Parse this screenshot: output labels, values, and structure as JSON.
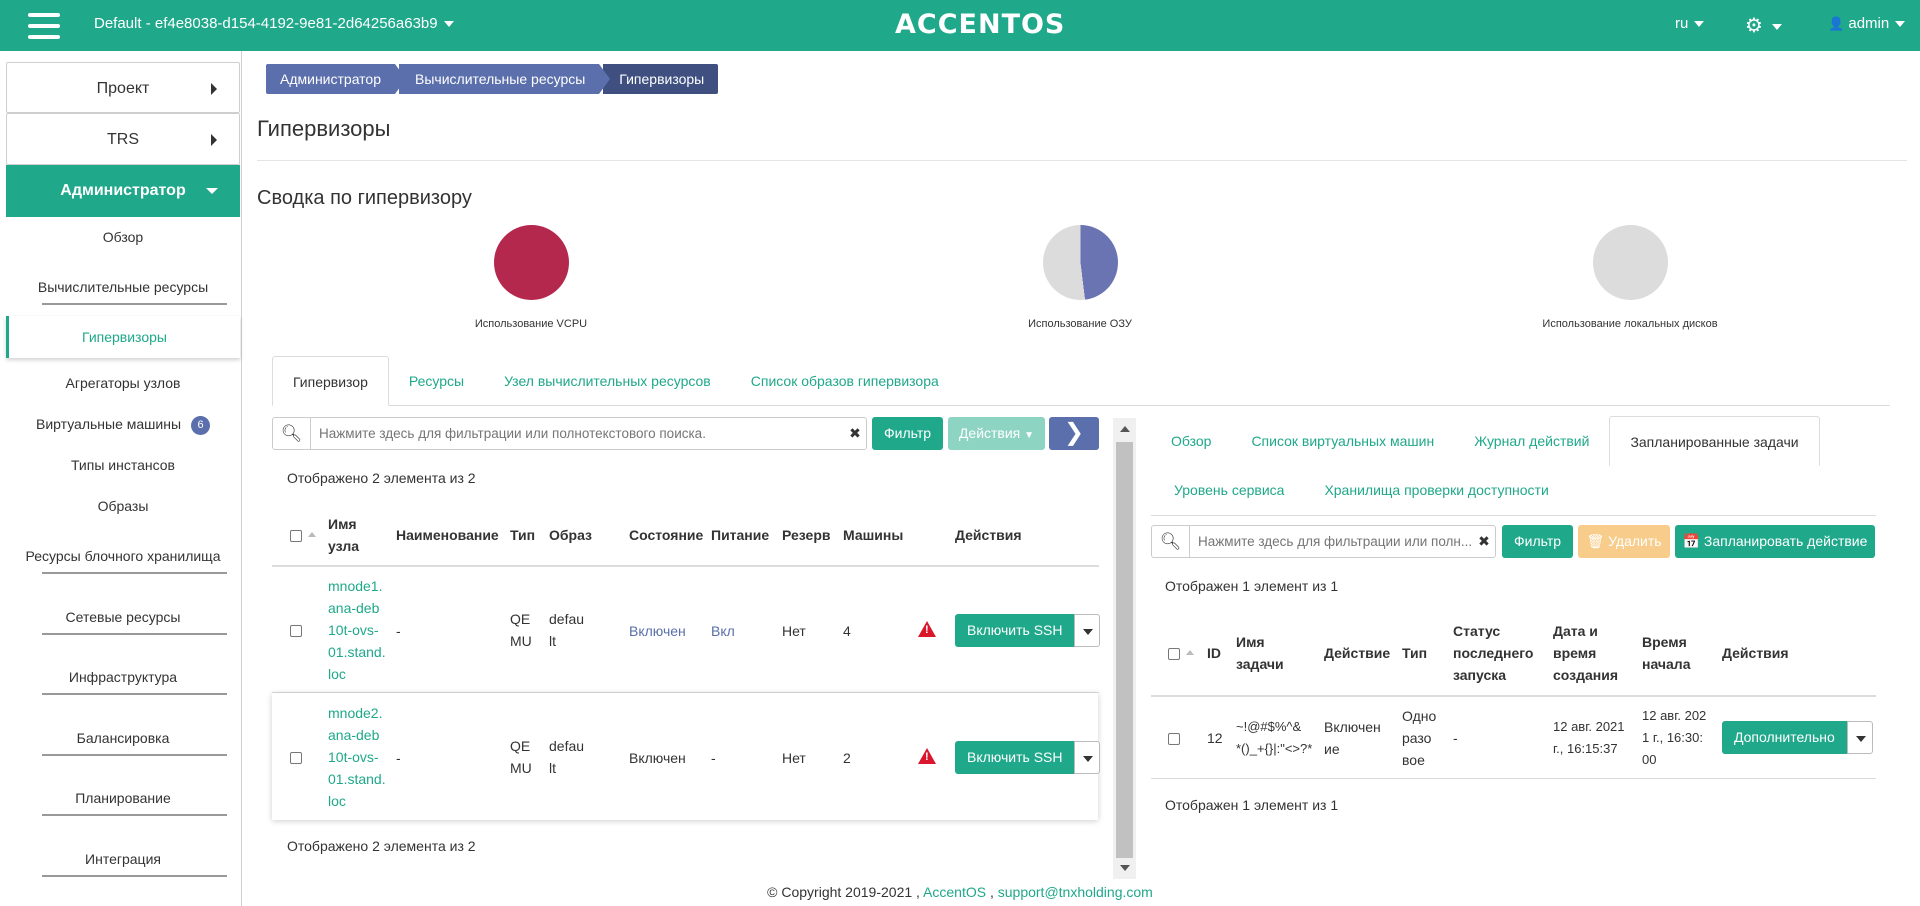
{
  "header": {
    "project": "Default - ef4e8038-d154-4192-9e81-2d64256a63b9",
    "logo": "ACCENTOS",
    "lang": "ru",
    "user": "admin",
    "brand_color": "#1fa88a"
  },
  "sidebar": {
    "project": "Проект",
    "trs": "TRS",
    "admin": "Администратор",
    "items": [
      {
        "label": "Обзор"
      },
      {
        "label": "Вычислительные ресурсы"
      },
      {
        "label": "Гипервизоры"
      },
      {
        "label": "Агрегаторы узлов"
      },
      {
        "label": "Виртуальные машины",
        "badge": "6"
      },
      {
        "label": "Типы инстансов"
      },
      {
        "label": "Образы"
      },
      {
        "label": "Ресурсы блочного хранилища"
      },
      {
        "label": "Сетевые ресурсы"
      },
      {
        "label": "Инфраструктура"
      },
      {
        "label": "Балансировка"
      },
      {
        "label": "Планирование"
      },
      {
        "label": "Интеграция"
      }
    ]
  },
  "breadcrumb": [
    "Администратор",
    "Вычислительные ресурсы",
    "Гипервизоры"
  ],
  "page_title": "Гипервизоры",
  "summary": {
    "title": "Сводка по гипервизору",
    "charts": [
      {
        "label": "Использование VCPU",
        "used_fraction": 1.0,
        "color": "#b5284e"
      },
      {
        "label": "Использование ОЗУ",
        "used_fraction": 0.48,
        "color": "#6b74b3"
      },
      {
        "label": "Использование локальных дисков",
        "used_fraction": 0.0,
        "color": "#dcdcdc"
      }
    ]
  },
  "left": {
    "tabs": [
      "Гипервизор",
      "Ресурсы",
      "Узел вычислительных ресурсов",
      "Список образов гипервизора"
    ],
    "search_placeholder": "Нажмите здесь для фильтрации или полнотекстового поиска.",
    "filter_btn": "Фильтр",
    "actions_btn": "Действия",
    "count_top": "Отображено 2 элемента из 2",
    "count_bottom": "Отображено 2 элемента из 2",
    "columns": [
      "Имя узла",
      "Наименование",
      "Тип",
      "Образ",
      "Состояние",
      "Питание",
      "Резерв",
      "Машины",
      "Действия"
    ],
    "rows": [
      {
        "name": "mnode1.\nana-deb\n10t-ovs-\n01.stand.\nloc",
        "title": "-",
        "type": "QE\nMU",
        "image": "defau\nlt",
        "state": "Включен",
        "power": "Вкл",
        "reserve": "Нет",
        "machines": "4",
        "action": "Включить SSH"
      },
      {
        "name": "mnode2.\nana-deb\n10t-ovs-\n01.stand.\nloc",
        "title": "-",
        "type": "QE\nMU",
        "image": "defau\nlt",
        "state": "Включен",
        "power": "-",
        "reserve": "Нет",
        "machines": "2",
        "action": "Включить SSH"
      }
    ]
  },
  "right": {
    "tabs_row1": [
      "Обзор",
      "Список виртуальных машин",
      "Журнал действий",
      "Запланированные задачи"
    ],
    "tabs_row2": [
      "Уровень сервиса",
      "Хранилища проверки доступности"
    ],
    "search_placeholder": "Нажмите здесь для фильтрации или полн...",
    "filter_btn": "Фильтр",
    "delete_btn": "Удалить",
    "plan_btn": "Запланировать действие",
    "count_top": "Отображен 1 элемент из 1",
    "count_bottom": "Отображен 1 элемент из 1",
    "columns": [
      "ID",
      "Имя\nзадачи",
      "Действие",
      "Тип",
      "Статус\nпоследнего\nзапуска",
      "Дата и\nвремя\nсоздания",
      "Время\nначала",
      "Действия"
    ],
    "rows": [
      {
        "id": "12",
        "name": "~!@#$%^&\n*()_+{}|:\"<>?*",
        "action": "Включен\nие",
        "type": "Одно\nразо\nвое",
        "status": "-",
        "created": "12 авг. 2021\nг., 16:15:37",
        "start": "12 авг. 202\n1 г., 16:30:\n00",
        "more": "Дополнительно"
      }
    ]
  },
  "footer": {
    "copyright": "© Copyright 2019-2021 ,",
    "brand_link": "AccentOS",
    "sep": ",",
    "email": "support@tnxholding.com"
  }
}
